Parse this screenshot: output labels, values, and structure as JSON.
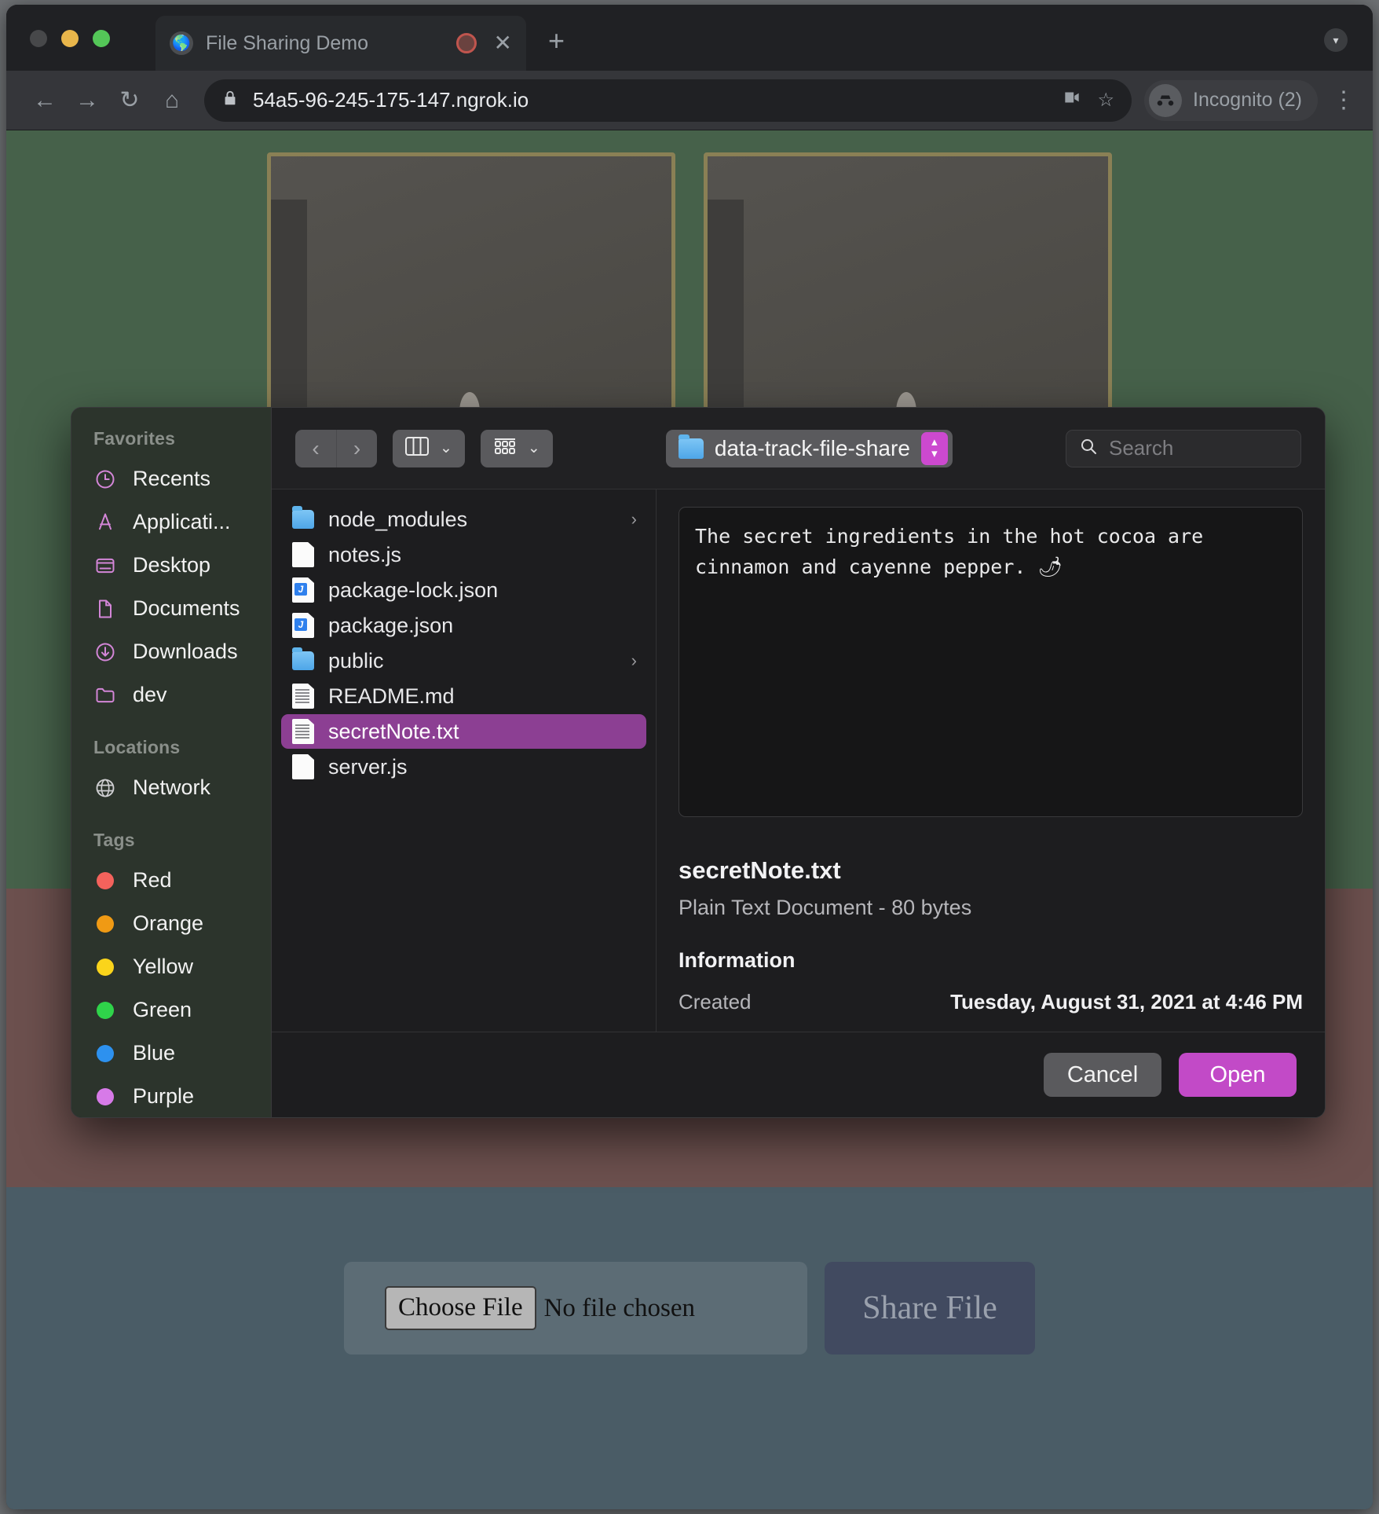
{
  "browser": {
    "tab": {
      "title": "File Sharing Demo",
      "favicon": "globe-icon",
      "recording": "recording-dot",
      "close": "✕"
    },
    "new_tab": "+",
    "tab_list_chevron": "▾",
    "nav": {
      "back": "←",
      "forward": "→",
      "reload": "↻",
      "home": "⌂"
    },
    "omnibox": {
      "lock": "🔒",
      "url": "54a5-96-245-175-147.ngrok.io",
      "camera": "■",
      "bookmark": "☆"
    },
    "profile": {
      "label": "Incognito (2)",
      "icon": "incognito-icon"
    },
    "menu": "⋮"
  },
  "page": {
    "choose_file_label": "Choose File",
    "no_file_label": "No file chosen",
    "share_button_label": "Share File"
  },
  "dialog": {
    "sidebar": {
      "favorites_header": "Favorites",
      "favorites": [
        {
          "label": "Recents",
          "icon": "clock-icon"
        },
        {
          "label": "Applicati...",
          "icon": "applications-icon"
        },
        {
          "label": "Desktop",
          "icon": "desktop-icon"
        },
        {
          "label": "Documents",
          "icon": "document-icon"
        },
        {
          "label": "Downloads",
          "icon": "download-icon"
        },
        {
          "label": "dev",
          "icon": "folder-outline-icon"
        }
      ],
      "locations_header": "Locations",
      "locations": [
        {
          "label": "Network",
          "icon": "globe-icon"
        }
      ],
      "tags_header": "Tags",
      "tags": [
        {
          "label": "Red",
          "color": "#f4625c"
        },
        {
          "label": "Orange",
          "color": "#f09a14"
        },
        {
          "label": "Yellow",
          "color": "#fad41b"
        },
        {
          "label": "Green",
          "color": "#2fd44a"
        },
        {
          "label": "Blue",
          "color": "#2d91ef"
        },
        {
          "label": "Purple",
          "color": "#d77ae8"
        }
      ]
    },
    "toolbar": {
      "back": "‹",
      "forward": "›",
      "view_chevron": "⌄",
      "arrange_chevron": "⌄",
      "path_label": "data-track-file-share",
      "path_folder_icon": "folder-icon",
      "stepper_up": "▴",
      "stepper_down": "▾",
      "search_placeholder": "Search",
      "search_icon": "search-icon"
    },
    "files": [
      {
        "name": "node_modules",
        "type": "folder",
        "chevron": "›"
      },
      {
        "name": "notes.js",
        "type": "doc",
        "chevron": ""
      },
      {
        "name": "package-lock.json",
        "type": "json",
        "chevron": ""
      },
      {
        "name": "package.json",
        "type": "json",
        "chevron": ""
      },
      {
        "name": "public",
        "type": "folder",
        "chevron": "›"
      },
      {
        "name": "README.md",
        "type": "text",
        "chevron": ""
      },
      {
        "name": "secretNote.txt",
        "type": "text",
        "chevron": "",
        "selected": true
      },
      {
        "name": "server.js",
        "type": "doc",
        "chevron": ""
      }
    ],
    "preview": {
      "content": "The secret ingredients in the hot cocoa are cinnamon and cayenne pepper. 🌶",
      "file_name": "secretNote.txt",
      "kind_and_size": "Plain Text Document - 80 bytes",
      "information_header": "Information",
      "created_label": "Created",
      "created_value": "Tuesday, August 31, 2021 at 4:46 PM"
    },
    "footer": {
      "cancel_label": "Cancel",
      "open_label": "Open"
    }
  },
  "colors": {
    "accent_purple": "#c24ac7",
    "selection_purple": "#8c3f93",
    "sidebar_icon": "#d486d8",
    "band_green": "#46614a",
    "band_maroon": "#6c504e",
    "band_slate": "#4a5c66"
  }
}
